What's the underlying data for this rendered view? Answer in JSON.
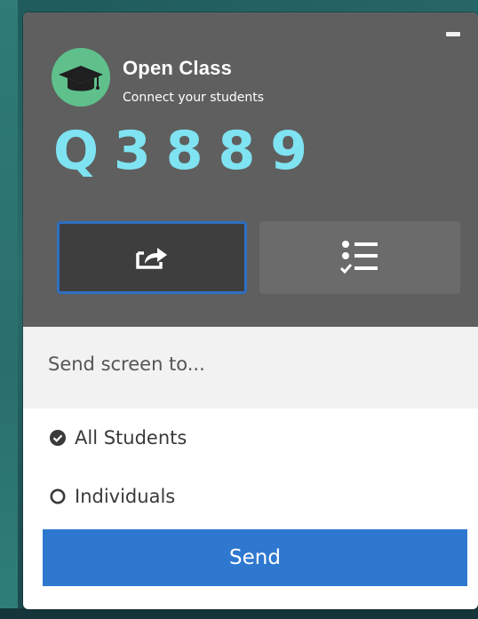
{
  "app": {
    "title": "Open Class",
    "subtitle": "Connect your students",
    "class_code": "Q3889"
  },
  "header": {
    "minimize_icon": "minimize-icon",
    "mode_buttons": [
      {
        "icon": "share-screen-icon",
        "selected": true
      },
      {
        "icon": "checklist-icon",
        "selected": false
      }
    ]
  },
  "send": {
    "prompt": "Send screen to...",
    "options": [
      {
        "label": "All Students",
        "checked": true
      },
      {
        "label": "Individuals",
        "checked": false
      }
    ],
    "button_label": "Send"
  },
  "colors": {
    "header_bg": "#5f5f5f",
    "code_color": "#7fe3f2",
    "logo_green": "#5fc08c",
    "accent_blue": "#2f78d0",
    "selected_outline": "#2f6fc1"
  }
}
